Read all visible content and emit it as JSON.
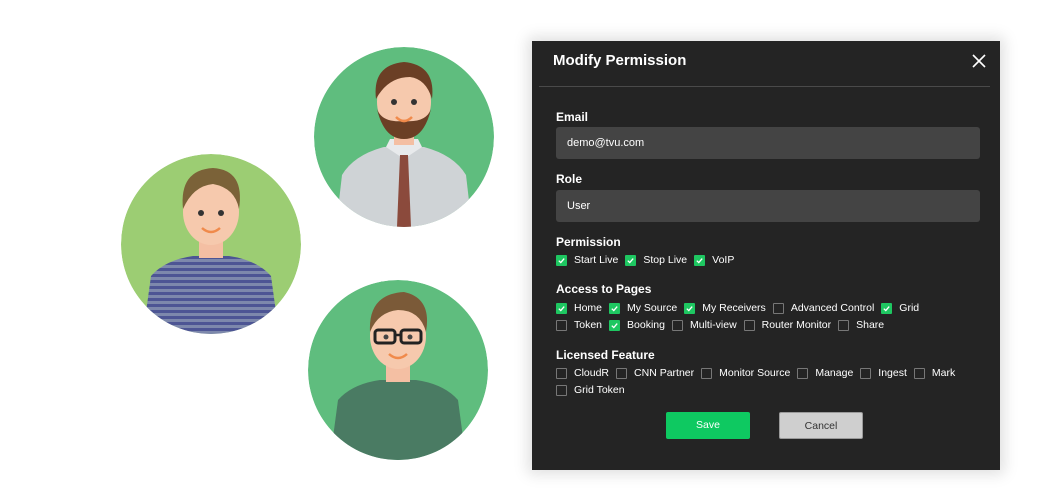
{
  "avatars": [
    {
      "name": "bearded-man-avatar",
      "bg": "#5fbd7e"
    },
    {
      "name": "striped-shirt-man-avatar",
      "bg": "#9ccd73"
    },
    {
      "name": "glasses-man-avatar",
      "bg": "#5fbd7e"
    }
  ],
  "modal": {
    "title": "Modify Permission",
    "close_icon": "close-icon",
    "email": {
      "label": "Email",
      "value": "demo@tvu.com"
    },
    "role": {
      "label": "Role",
      "value": "User"
    },
    "permission": {
      "label": "Permission",
      "items": [
        {
          "label": "Start Live",
          "checked": true
        },
        {
          "label": "Stop Live",
          "checked": true
        },
        {
          "label": "VoIP",
          "checked": true
        }
      ]
    },
    "access_to_pages": {
      "label": "Access to Pages",
      "rows": [
        [
          {
            "label": "Home",
            "checked": true
          },
          {
            "label": "My Source",
            "checked": true
          },
          {
            "label": "My Receivers",
            "checked": true
          },
          {
            "label": "Advanced Control",
            "checked": false
          },
          {
            "label": "Grid",
            "checked": true
          }
        ],
        [
          {
            "label": "Token",
            "checked": false
          },
          {
            "label": "Booking",
            "checked": true
          },
          {
            "label": "Multi-view",
            "checked": false
          },
          {
            "label": "Router Monitor",
            "checked": false
          },
          {
            "label": "Share",
            "checked": false
          }
        ]
      ]
    },
    "licensed_feature": {
      "label": "Licensed Feature",
      "rows": [
        [
          {
            "label": "CloudR",
            "checked": false
          },
          {
            "label": "CNN Partner",
            "checked": false
          },
          {
            "label": "Monitor Source",
            "checked": false
          },
          {
            "label": "Manage",
            "checked": false
          },
          {
            "label": "Ingest",
            "checked": false
          },
          {
            "label": "Mark",
            "checked": false
          }
        ],
        [
          {
            "label": "Grid Token",
            "checked": false
          }
        ]
      ]
    },
    "save_label": "Save",
    "cancel_label": "Cancel",
    "accent_color": "#1ec761"
  }
}
